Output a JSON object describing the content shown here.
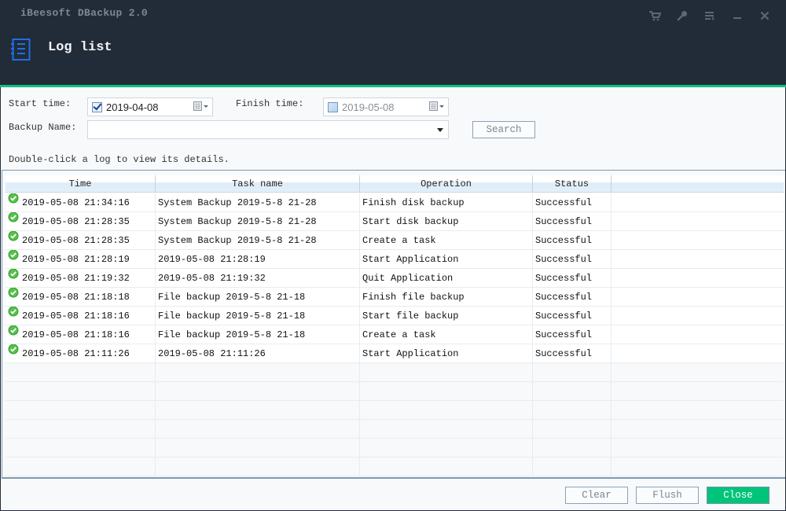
{
  "app": {
    "title": "iBeesoft DBackup 2.0",
    "page_title": "Log list",
    "window_controls": [
      {
        "name": "cart-icon"
      },
      {
        "name": "key-icon"
      },
      {
        "name": "menu-icon"
      },
      {
        "name": "minimize-icon"
      },
      {
        "name": "close-icon"
      }
    ],
    "accent_color": "#0fc27e"
  },
  "filters": {
    "start_time_label": "Start time:",
    "start_time_checked": true,
    "start_time_value": "2019-04-08",
    "finish_time_label": "Finish time:",
    "finish_time_checked": false,
    "finish_time_value": "2019-05-08",
    "backup_name_label": "Backup Name:",
    "backup_name_value": "",
    "search_label": "Search"
  },
  "hint": "Double-click a log to view its details.",
  "table": {
    "columns": [
      "Time",
      "Task name",
      "Operation",
      "Status",
      ""
    ],
    "rows": [
      {
        "time": "2019-05-08 21:34:16",
        "task": "System Backup 2019-5-8 21-28",
        "operation": "Finish disk backup",
        "status": "Successful"
      },
      {
        "time": "2019-05-08 21:28:35",
        "task": "System Backup 2019-5-8 21-28",
        "operation": "Start disk backup",
        "status": "Successful"
      },
      {
        "time": "2019-05-08 21:28:35",
        "task": "System Backup 2019-5-8 21-28",
        "operation": "Create a task",
        "status": "Successful"
      },
      {
        "time": "2019-05-08 21:28:19",
        "task": "2019-05-08 21:28:19",
        "operation": "Start Application",
        "status": "Successful"
      },
      {
        "time": "2019-05-08 21:19:32",
        "task": "2019-05-08 21:19:32",
        "operation": "Quit Application",
        "status": "Successful"
      },
      {
        "time": "2019-05-08 21:18:18",
        "task": "File backup 2019-5-8 21-18",
        "operation": "Finish file backup",
        "status": "Successful"
      },
      {
        "time": "2019-05-08 21:18:16",
        "task": "File backup 2019-5-8 21-18",
        "operation": "Start file backup",
        "status": "Successful"
      },
      {
        "time": "2019-05-08 21:18:16",
        "task": "File backup 2019-5-8 21-18",
        "operation": "Create a task",
        "status": "Successful"
      },
      {
        "time": "2019-05-08 21:11:26",
        "task": "2019-05-08 21:11:26",
        "operation": "Start Application",
        "status": "Successful"
      }
    ],
    "status_icon": "success-check-icon"
  },
  "footer": {
    "clear_label": "Clear",
    "flush_label": "Flush",
    "close_label": "Close"
  }
}
